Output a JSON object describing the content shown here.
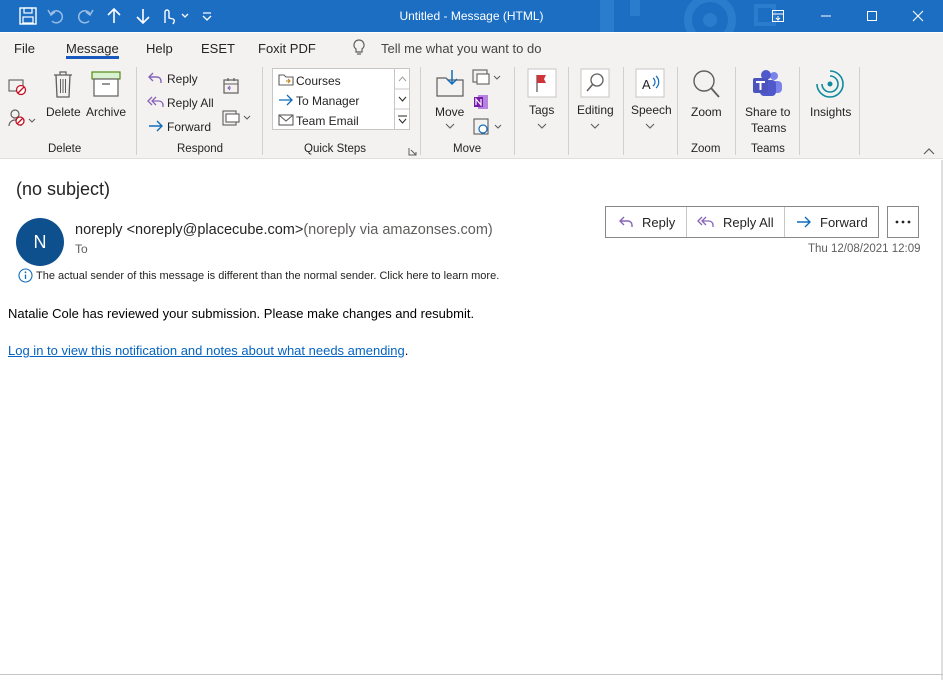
{
  "titlebar": {
    "title": "Untitled  -  Message (HTML)"
  },
  "menu": {
    "tabs": [
      "File",
      "Message",
      "Help",
      "ESET",
      "Foxit PDF"
    ],
    "search_placeholder": "Tell me what you want to do",
    "active_tab": "Message"
  },
  "ribbon": {
    "delete": {
      "delete_label": "Delete",
      "archive_label": "Archive",
      "group_label": "Delete"
    },
    "respond": {
      "reply_label": "Reply",
      "reply_all_label": "Reply All",
      "forward_label": "Forward",
      "group_label": "Respond"
    },
    "quick_steps": {
      "items": [
        "Courses",
        "To Manager",
        "Team Email"
      ],
      "group_label": "Quick Steps"
    },
    "move": {
      "move_label": "Move",
      "group_label": "Move"
    },
    "tags": {
      "label": "Tags"
    },
    "editing": {
      "label": "Editing"
    },
    "speech": {
      "label": "Speech"
    },
    "zoom": {
      "label": "Zoom",
      "group_label": "Zoom"
    },
    "teams": {
      "share_label_1": "Share to",
      "share_label_2": "Teams",
      "group_label": "Teams"
    },
    "insights": {
      "label": "Insights"
    }
  },
  "message": {
    "subject": "(no subject)",
    "avatar_initial": "N",
    "sender_name": "noreply",
    "sender_email": "<noreply@placecube.com>",
    "sender_via": "(noreply via amazonses.com)",
    "to_label": "To",
    "reply_label": "Reply",
    "reply_all_label": "Reply All",
    "forward_label": "Forward",
    "more_label": "···",
    "date": "Thu 12/08/2021 12:09",
    "notice": "The actual sender of this message is different than the normal sender. Click here to learn more.",
    "body_text": "Natalie Cole has reviewed your submission. Please make changes and resubmit.",
    "link_text": "Log in to view this notification and notes about what needs amending",
    "link_suffix": "."
  },
  "colors": {
    "titlebar": "#1c6ec3",
    "accent": "#185abd",
    "avatar": "#0e4f8e",
    "link": "#0563c1"
  }
}
